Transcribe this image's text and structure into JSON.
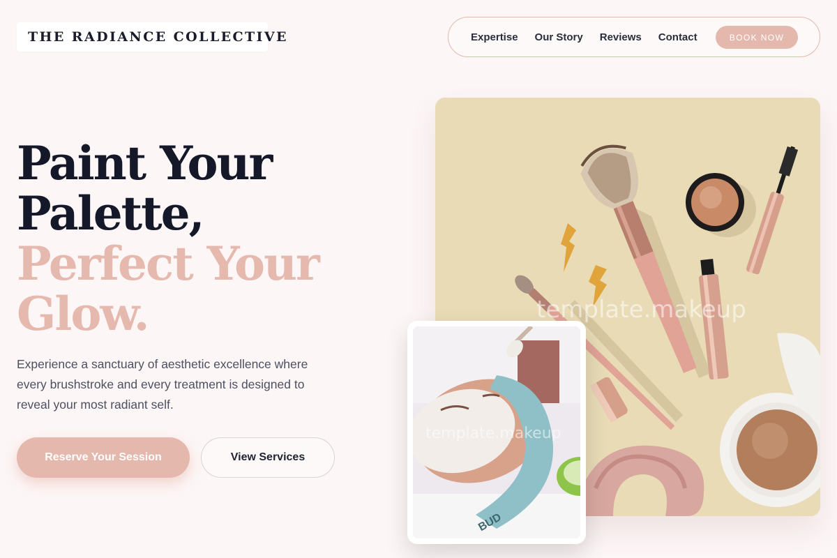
{
  "brand": {
    "name": "THE RADIANCE COLLECTIVE"
  },
  "nav": {
    "links": [
      "Expertise",
      "Our Story",
      "Reviews",
      "Contact"
    ],
    "cta": "BOOK NOW"
  },
  "hero": {
    "title_lines": [
      "Paint Your",
      "Palette,"
    ],
    "accent_lines": [
      "Perfect Your",
      "Glow."
    ],
    "description": "Experience a sanctuary of aesthetic excellence where every brushstroke and every treatment is designed to reveal your most radiant self.",
    "primary_cta": "Reserve Your Session",
    "secondary_cta": "View Services"
  },
  "images": {
    "main_watermark": "template.makeup",
    "inset_watermark": "template.makeup"
  },
  "colors": {
    "accent": "#e5b8ad",
    "background": "#fdf6f6",
    "heading": "#141828",
    "product_backdrop": "#e8dbb6"
  }
}
